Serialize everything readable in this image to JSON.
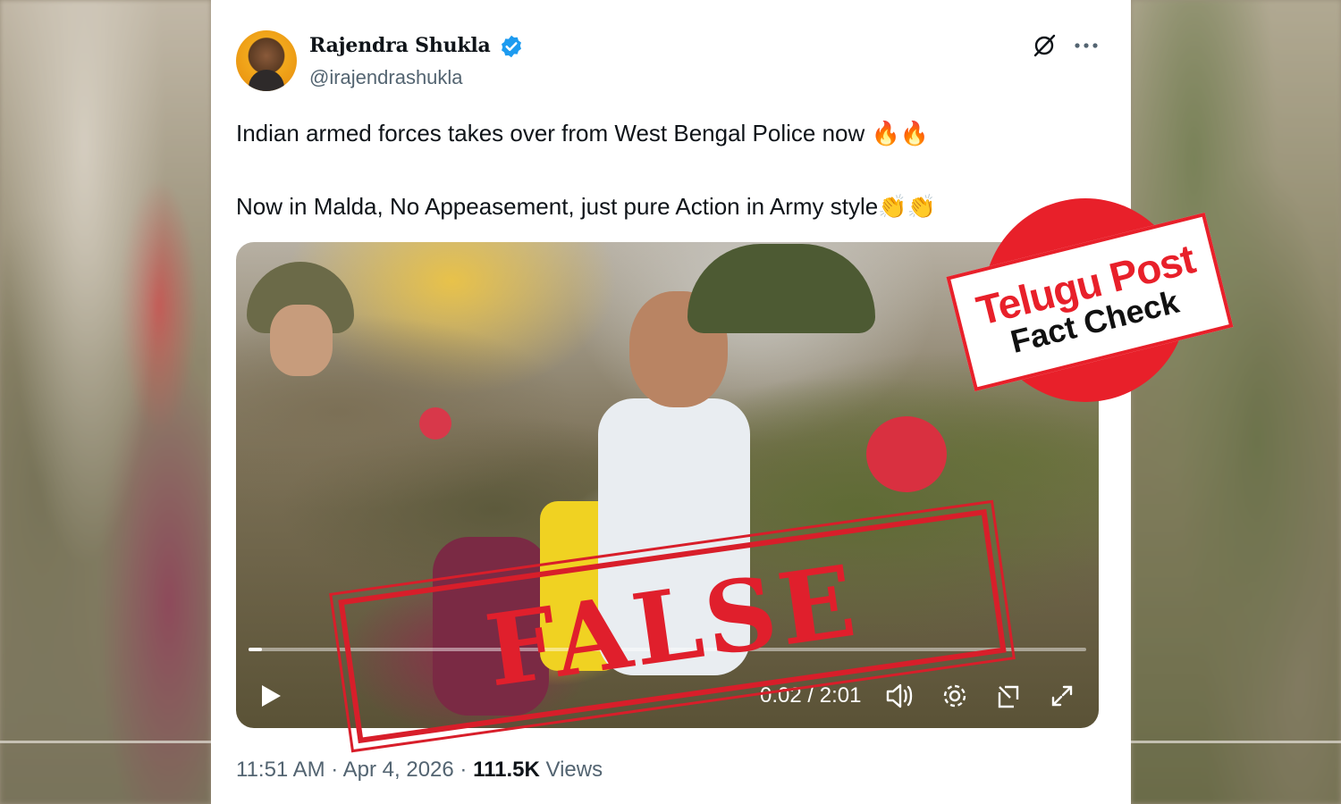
{
  "post": {
    "author_name": "Rajendra Shukla",
    "handle": "@irajendrashukla",
    "text_line1": "Indian armed forces takes over from West Bengal Police now",
    "text_line1_emoji": "🔥🔥",
    "text_line2": "Now in Malda, No Appeasement, just pure Action in Army style",
    "text_line2_emoji": "👏👏",
    "time": "11:51 AM",
    "separator": "·",
    "date": "Apr 4, 2026",
    "views_count": "111.5K",
    "views_label": "Views"
  },
  "video": {
    "time_display": "0:02 / 2:01",
    "progress_fraction": 0.0165
  },
  "stamps": {
    "false_label": "FALSE",
    "badge_title": "Telugu Post",
    "badge_subtitle": "Fact Check"
  },
  "colors": {
    "verified_blue": "#1d9bf0",
    "stamp_red": "#e01f2c"
  },
  "icons": [
    "verified-badge-icon",
    "grok-icon",
    "more-icon",
    "play-icon",
    "volume-icon",
    "settings-icon",
    "popout-icon",
    "fullscreen-icon"
  ]
}
